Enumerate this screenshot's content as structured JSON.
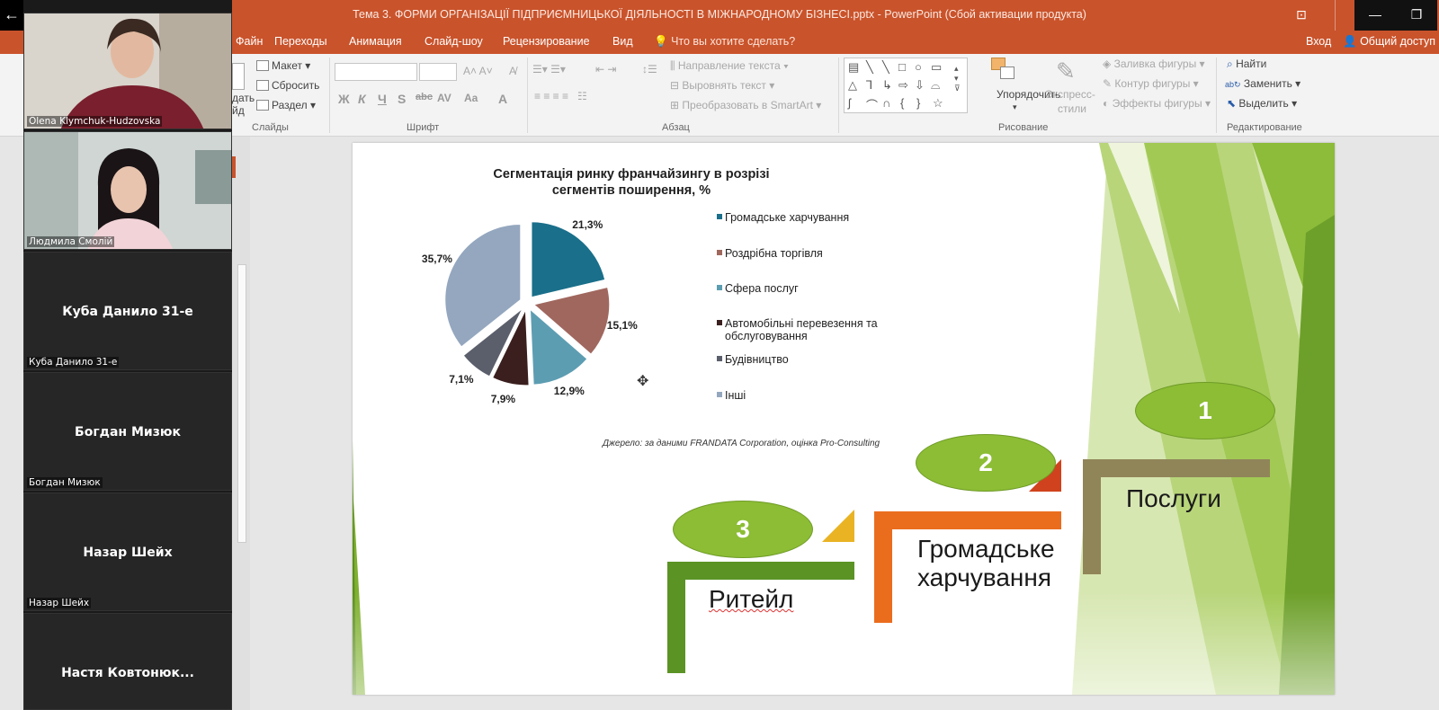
{
  "window": {
    "title": "Тема 3. ФОРМИ ОРГАНІЗАЦІЇ ПІДПРИЄМНИЦЬКОЇ ДІЯЛЬНОСТІ В МІЖНАРОДНОМУ БІЗНЕСІ.pptx - PowerPoint (Сбой активации продукта)"
  },
  "ribbon_tabs": [
    "Файн",
    "Переходы",
    "Анимация",
    "Слайд-шоу",
    "Рецензирование",
    "Вид"
  ],
  "tell_me": "Что вы хотите сделать?",
  "login": "Вход",
  "share": "Общий доступ",
  "ribbon": {
    "slides": {
      "new_slide_partial_1": "дать",
      "new_slide_partial_2": "йд",
      "layout": "Макет",
      "reset": "Сбросить",
      "section": "Раздел",
      "label": "Слайды"
    },
    "font": {
      "label": "Шрифт"
    },
    "paragraph": {
      "text_direction": "Направление текста",
      "align_text": "Выровнять текст",
      "smartart": "Преобразовать в SmartArt",
      "label": "Абзац"
    },
    "drawing": {
      "arrange": "Упорядочить",
      "quick_styles_1": "Экспресс-",
      "quick_styles_2": "стили",
      "shape_fill": "Заливка фигуры",
      "shape_outline": "Контур фигуры",
      "shape_effects": "Эффекты фигуры",
      "label": "Рисование"
    },
    "editing": {
      "find": "Найти",
      "replace": "Заменить",
      "select": "Выделить",
      "label": "Редактирование"
    }
  },
  "slide": {
    "labels": {
      "seg1": "Послуги",
      "seg2_line1": "Громадське",
      "seg2_line2": "харчування",
      "seg3": "Ритейл"
    },
    "ovals": {
      "one": "1",
      "two": "2",
      "three": "3"
    }
  },
  "chart_data": {
    "type": "pie",
    "title_line1": "Сегментація ринку франчайзингу в розрізі",
    "title_line2": "сегментів поширення, %",
    "categories": [
      "Громадське харчування",
      "Роздрібна торгівля",
      "Сфера послуг",
      "Автомобільні перевезення та обслуговування",
      "Будівництво",
      "Інші"
    ],
    "legend_line1": [
      "Громадське харчування",
      "Роздрібна торгівля",
      "Сфера послуг",
      "Автомобільні перевезення та",
      "Будівництво",
      "Інші"
    ],
    "legend_line2": [
      "",
      "",
      "",
      "обслуговування",
      "",
      ""
    ],
    "values": [
      21.3,
      15.1,
      12.9,
      7.9,
      7.1,
      35.7
    ],
    "value_labels": [
      "21,3%",
      "15,1%",
      "12,9%",
      "7,9%",
      "7,1%",
      "35,7%"
    ],
    "colors": [
      "#1a6f8a",
      "#a0675e",
      "#5d9db2",
      "#3a1f1e",
      "#5b5f6b",
      "#94a7bf"
    ],
    "legend_position": "right",
    "source": "Джерело: за даними FRANDATA Corporation, оцінка Pro-Consulting"
  },
  "participants": [
    {
      "name": "Olena Klymchuk-Hudzovska",
      "video": true
    },
    {
      "name": "Людмила Смолій",
      "video": true
    },
    {
      "name": "Куба Данило 31-е",
      "label": "Куба Данило 31-е",
      "video": false
    },
    {
      "name": "Богдан Мизюк",
      "label": "Богдан Мизюк",
      "video": false
    },
    {
      "name": "Назар Шейх",
      "label": "Назар Шейх",
      "video": false
    },
    {
      "name": "Настя  Ковтонюк...",
      "video": false
    }
  ]
}
